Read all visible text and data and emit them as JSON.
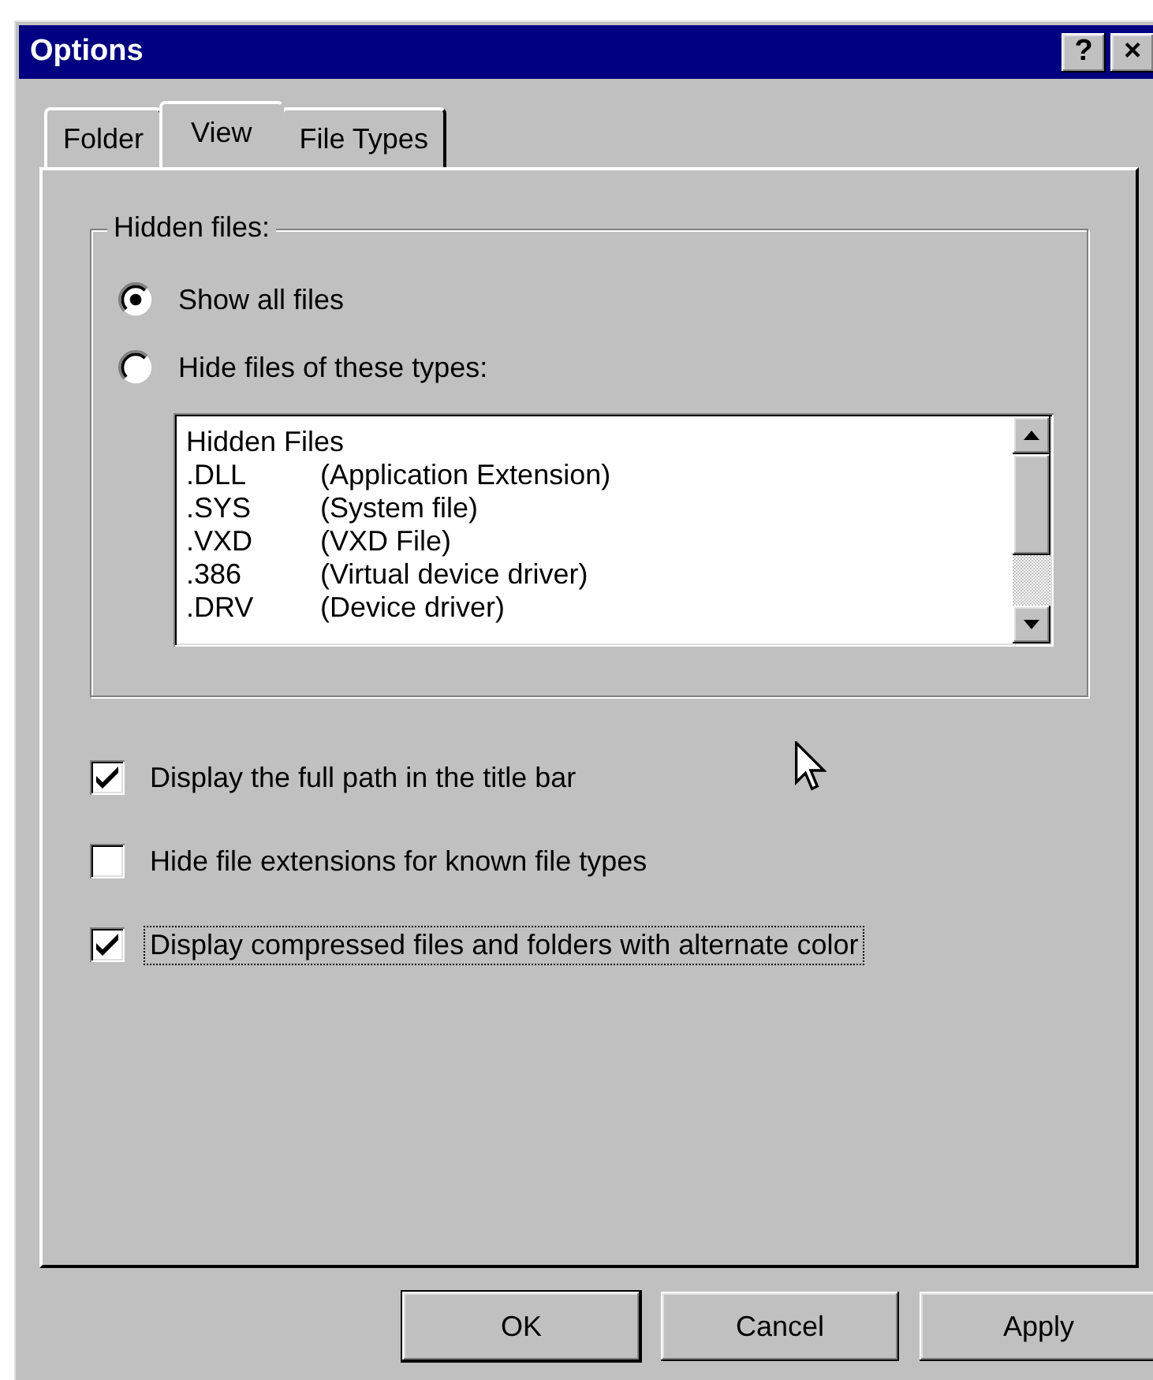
{
  "window": {
    "title": "Options",
    "help_button": "?",
    "close_button": "×"
  },
  "tabs": [
    {
      "label": "Folder",
      "selected": false
    },
    {
      "label": "View",
      "selected": true
    },
    {
      "label": "File Types",
      "selected": false
    }
  ],
  "hidden_files": {
    "label": "Hidden files:",
    "options": [
      {
        "label": "Show all files",
        "selected": true
      },
      {
        "label": "Hide files of these types:",
        "selected": false
      }
    ],
    "list": {
      "header": "Hidden Files",
      "rows": [
        {
          "extension": ".DLL",
          "description": "(Application Extension)"
        },
        {
          "extension": ".SYS",
          "description": "(System file)"
        },
        {
          "extension": ".VXD",
          "description": "(VXD File)"
        },
        {
          "extension": ".386",
          "description": "(Virtual device driver)"
        },
        {
          "extension": ".DRV",
          "description": "(Device driver)"
        }
      ]
    }
  },
  "checkboxes": [
    {
      "label": "Display the full path in the title bar",
      "checked": true,
      "focused": false
    },
    {
      "label": "Hide file extensions for known file types",
      "checked": false,
      "focused": false
    },
    {
      "label": "Display compressed files and folders with alternate color",
      "checked": true,
      "focused": true
    }
  ],
  "buttons": [
    {
      "label": "OK",
      "default": true
    },
    {
      "label": "Cancel",
      "default": false
    },
    {
      "label": "Apply",
      "default": false
    }
  ]
}
